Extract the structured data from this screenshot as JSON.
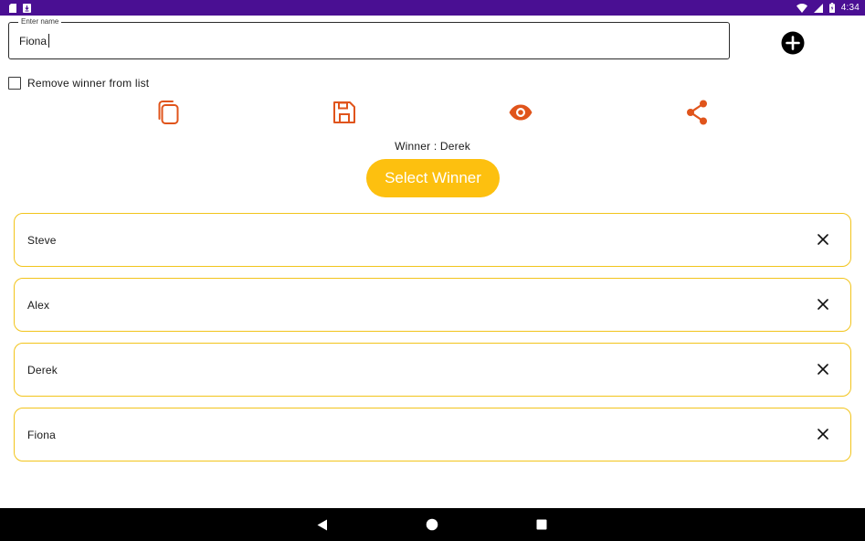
{
  "status_bar": {
    "time": "4:34",
    "left_icons": [
      "sd-card-icon",
      "download-icon"
    ],
    "right_icons": [
      "wifi-icon",
      "signal-icon",
      "battery-icon"
    ]
  },
  "input": {
    "label": "Enter name",
    "value": "Fiona"
  },
  "add_button": {
    "icon": "plus-circle-icon"
  },
  "remove_winner": {
    "label": "Remove winner from list",
    "checked": false
  },
  "actions": [
    {
      "name": "copy",
      "icon": "copy-icon"
    },
    {
      "name": "save",
      "icon": "save-icon"
    },
    {
      "name": "view",
      "icon": "eye-icon"
    },
    {
      "name": "share",
      "icon": "share-icon"
    }
  ],
  "winner": {
    "text": "Winner : Derek"
  },
  "select_button": {
    "label": "Select Winner"
  },
  "names": [
    {
      "name": "Steve"
    },
    {
      "name": "Alex"
    },
    {
      "name": "Derek"
    },
    {
      "name": "Fiona"
    }
  ],
  "colors": {
    "status_bar": "#4a0f93",
    "accent_orange": "#e0541b",
    "button_yellow": "#fdc00f",
    "card_border": "#f2c41b"
  }
}
